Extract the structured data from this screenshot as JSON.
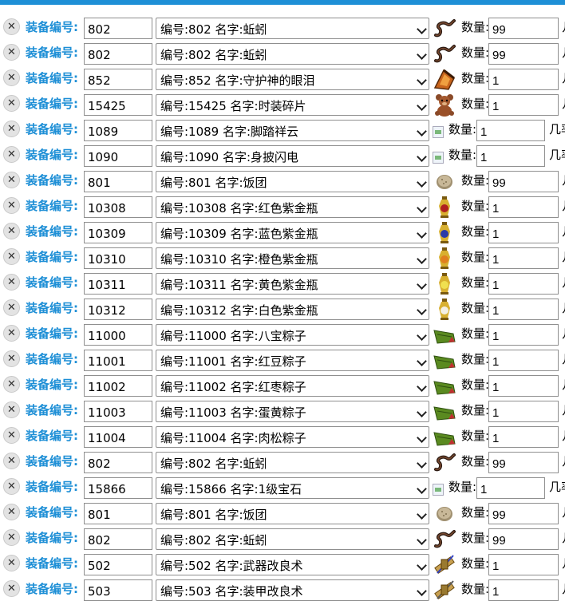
{
  "header": {
    "accent": "#1e8fd6"
  },
  "rows": [
    {
      "label": "装备编号:",
      "id": "802",
      "select": "编号:802 名字:蚯蚓",
      "icon": "worm-icon",
      "qty_label": "数量:",
      "qty": "99",
      "tail": "几",
      "broken": false
    },
    {
      "label": "装备编号:",
      "id": "802",
      "select": "编号:802 名字:蚯蚓",
      "icon": "worm-icon",
      "qty_label": "数量:",
      "qty": "99",
      "tail": "几",
      "broken": false
    },
    {
      "label": "装备编号:",
      "id": "852",
      "select": "编号:852 名字:守护神的眼泪",
      "icon": "teardrop-gem-icon",
      "qty_label": "数量:",
      "qty": "1",
      "tail": "几",
      "broken": false
    },
    {
      "label": "装备编号:",
      "id": "15425",
      "select": "编号:15425 名字:时装碎片",
      "icon": "teddy-bear-icon",
      "qty_label": "数量:",
      "qty": "1",
      "tail": "几",
      "broken": false
    },
    {
      "label": "装备编号:",
      "id": "1089",
      "select": "编号:1089 名字:脚踏祥云",
      "icon": "broken-image-icon",
      "qty_label": "数量:",
      "qty": "1",
      "tail": "几率",
      "broken": true
    },
    {
      "label": "装备编号:",
      "id": "1090",
      "select": "编号:1090 名字:身披闪电",
      "icon": "broken-image-icon",
      "qty_label": "数量:",
      "qty": "1",
      "tail": "几率",
      "broken": true
    },
    {
      "label": "装备编号:",
      "id": "801",
      "select": "编号:801 名字:饭团",
      "icon": "rice-ball-icon",
      "qty_label": "数量:",
      "qty": "99",
      "tail": "几",
      "broken": false
    },
    {
      "label": "装备编号:",
      "id": "10308",
      "select": "编号:10308 名字:红色紫金瓶",
      "icon": "red-vase-icon",
      "qty_label": "数量:",
      "qty": "1",
      "tail": "几",
      "broken": false
    },
    {
      "label": "装备编号:",
      "id": "10309",
      "select": "编号:10309 名字:蓝色紫金瓶",
      "icon": "blue-vase-icon",
      "qty_label": "数量:",
      "qty": "1",
      "tail": "几",
      "broken": false
    },
    {
      "label": "装备编号:",
      "id": "10310",
      "select": "编号:10310 名字:橙色紫金瓶",
      "icon": "orange-vase-icon",
      "qty_label": "数量:",
      "qty": "1",
      "tail": "几",
      "broken": false
    },
    {
      "label": "装备编号:",
      "id": "10311",
      "select": "编号:10311 名字:黄色紫金瓶",
      "icon": "yellow-vase-icon",
      "qty_label": "数量:",
      "qty": "1",
      "tail": "几",
      "broken": false
    },
    {
      "label": "装备编号:",
      "id": "10312",
      "select": "编号:10312 名字:白色紫金瓶",
      "icon": "white-vase-icon",
      "qty_label": "数量:",
      "qty": "1",
      "tail": "几",
      "broken": false
    },
    {
      "label": "装备编号:",
      "id": "11000",
      "select": "编号:11000 名字:八宝粽子",
      "icon": "zongzi-icon",
      "qty_label": "数量:",
      "qty": "1",
      "tail": "几",
      "broken": false
    },
    {
      "label": "装备编号:",
      "id": "11001",
      "select": "编号:11001 名字:红豆粽子",
      "icon": "zongzi-icon",
      "qty_label": "数量:",
      "qty": "1",
      "tail": "几",
      "broken": false
    },
    {
      "label": "装备编号:",
      "id": "11002",
      "select": "编号:11002 名字:红枣粽子",
      "icon": "zongzi-icon",
      "qty_label": "数量:",
      "qty": "1",
      "tail": "几",
      "broken": false
    },
    {
      "label": "装备编号:",
      "id": "11003",
      "select": "编号:11003 名字:蛋黄粽子",
      "icon": "zongzi-icon",
      "qty_label": "数量:",
      "qty": "1",
      "tail": "几",
      "broken": false
    },
    {
      "label": "装备编号:",
      "id": "11004",
      "select": "编号:11004 名字:肉松粽子",
      "icon": "zongzi-icon",
      "qty_label": "数量:",
      "qty": "1",
      "tail": "几",
      "broken": false
    },
    {
      "label": "装备编号:",
      "id": "802",
      "select": "编号:802 名字:蚯蚓",
      "icon": "worm-icon",
      "qty_label": "数量:",
      "qty": "99",
      "tail": "几",
      "broken": false
    },
    {
      "label": "装备编号:",
      "id": "15866",
      "select": "编号:15866 名字:1级宝石",
      "icon": "broken-image-icon",
      "qty_label": "数量:",
      "qty": "1",
      "tail": "几率",
      "broken": true
    },
    {
      "label": "装备编号:",
      "id": "801",
      "select": "编号:801 名字:饭团",
      "icon": "rice-ball-icon",
      "qty_label": "数量:",
      "qty": "99",
      "tail": "几",
      "broken": false
    },
    {
      "label": "装备编号:",
      "id": "802",
      "select": "编号:802 名字:蚯蚓",
      "icon": "worm-icon",
      "qty_label": "数量:",
      "qty": "99",
      "tail": "几",
      "broken": false
    },
    {
      "label": "装备编号:",
      "id": "502",
      "select": "编号:502 名字:武器改良术",
      "icon": "weapon-scroll-icon",
      "qty_label": "数量:",
      "qty": "1",
      "tail": "几",
      "broken": false
    },
    {
      "label": "装备编号:",
      "id": "503",
      "select": "编号:503 名字:装甲改良术",
      "icon": "armor-scroll-icon",
      "qty_label": "数量:",
      "qty": "1",
      "tail": "几",
      "broken": false
    }
  ]
}
